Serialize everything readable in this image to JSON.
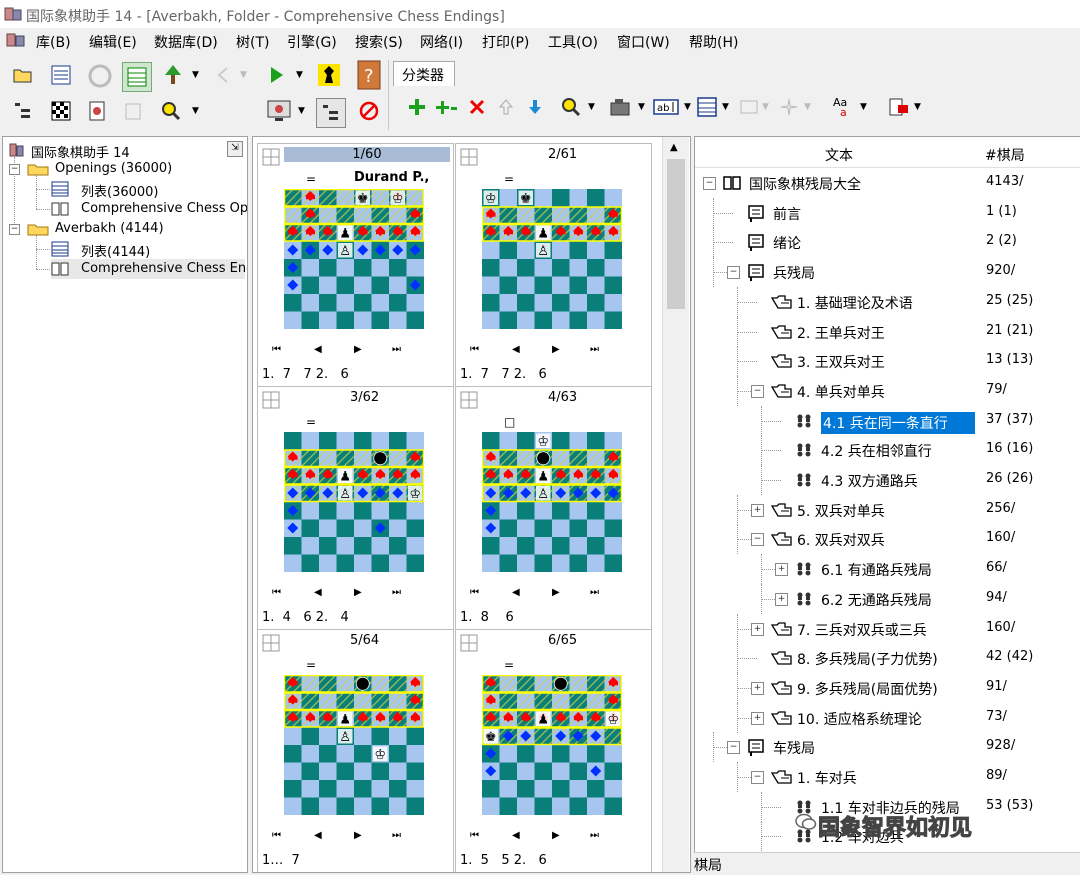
{
  "window": {
    "title": "国际象棋助手 14 - [Averbakh, Folder - Comprehensive Chess Endings]"
  },
  "menu": [
    "库(B)",
    "编辑(E)",
    "数据库(D)",
    "树(T)",
    "引擎(G)",
    "搜索(S)",
    "网络(I)",
    "打印(P)",
    "工具(O)",
    "窗口(W)",
    "帮助(H)"
  ],
  "tab": {
    "label": "分类器"
  },
  "left_tree": {
    "root": "国际象棋助手 14",
    "items": [
      {
        "label": "Openings (36000)"
      },
      {
        "label": "列表(36000)"
      },
      {
        "label": "Comprehensive Chess Oper"
      },
      {
        "label": "Averbakh (4144)"
      },
      {
        "label": "列表(4144)"
      },
      {
        "label": "Comprehensive Chess Endir"
      }
    ]
  },
  "games": [
    {
      "num": "1/60",
      "eq": "=",
      "name": "Durand P.,",
      "moves": "1.  7   7 2.   6",
      "selected": true
    },
    {
      "num": "2/61",
      "eq": "=",
      "name": "",
      "moves": "1.  7   7 2.   6",
      "selected": false
    },
    {
      "num": "3/62",
      "eq": "=",
      "name": "",
      "moves": "1.  4   6 2.   4",
      "selected": false
    },
    {
      "num": "4/63",
      "eq": "□",
      "name": "",
      "moves": "1.  8    6",
      "selected": false
    },
    {
      "num": "5/64",
      "eq": "=",
      "name": "",
      "moves": "1…  7",
      "selected": false
    },
    {
      "num": "6/65",
      "eq": "=",
      "name": "",
      "moves": "1.  5   5 2.   6",
      "selected": false
    }
  ],
  "right_tree": {
    "headers": {
      "text": "文本",
      "count": "#棋局"
    },
    "rows": [
      {
        "label": "国际象棋残局大全",
        "count": "4143/",
        "level": 0,
        "exp": "−",
        "icon": "book-icon"
      },
      {
        "label": "前言",
        "count": "1 (1)",
        "level": 1,
        "exp": "",
        "icon": "page-icon"
      },
      {
        "label": "绪论",
        "count": "2 (2)",
        "level": 1,
        "exp": "",
        "icon": "page-icon"
      },
      {
        "label": "兵残局",
        "count": "920/",
        "level": 1,
        "exp": "−",
        "icon": "page-icon"
      },
      {
        "label": "1. 基础理论及术语",
        "count": "25 (25)",
        "level": 2,
        "exp": "",
        "icon": "note-icon"
      },
      {
        "label": "2. 王单兵对王",
        "count": "21 (21)",
        "level": 2,
        "exp": "",
        "icon": "note-icon"
      },
      {
        "label": "3. 王双兵对王",
        "count": "13 (13)",
        "level": 2,
        "exp": "",
        "icon": "note-icon"
      },
      {
        "label": "4. 单兵对单兵",
        "count": "79/",
        "level": 2,
        "exp": "−",
        "icon": "note-icon"
      },
      {
        "label": "4.1 兵在同一条直行",
        "count": "37 (37)",
        "level": 3,
        "exp": "",
        "icon": "pieces-icon",
        "selected": true
      },
      {
        "label": "4.2 兵在相邻直行",
        "count": "16 (16)",
        "level": 3,
        "exp": "",
        "icon": "pieces-icon"
      },
      {
        "label": "4.3 双方通路兵",
        "count": "26 (26)",
        "level": 3,
        "exp": "",
        "icon": "pieces-icon"
      },
      {
        "label": "5. 双兵对单兵",
        "count": "256/",
        "level": 2,
        "exp": "+",
        "icon": "note-icon"
      },
      {
        "label": "6. 双兵对双兵",
        "count": "160/",
        "level": 2,
        "exp": "−",
        "icon": "note-icon"
      },
      {
        "label": "6.1 有通路兵残局",
        "count": "66/",
        "level": 3,
        "exp": "+",
        "icon": "pieces-icon"
      },
      {
        "label": "6.2 无通路兵残局",
        "count": "94/",
        "level": 3,
        "exp": "+",
        "icon": "pieces-icon"
      },
      {
        "label": "7. 三兵对双兵或三兵",
        "count": "160/",
        "level": 2,
        "exp": "+",
        "icon": "note-icon"
      },
      {
        "label": "8. 多兵残局(子力优势)",
        "count": "42 (42)",
        "level": 2,
        "exp": "",
        "icon": "note-icon"
      },
      {
        "label": "9. 多兵残局(局面优势)",
        "count": "91/",
        "level": 2,
        "exp": "+",
        "icon": "note-icon"
      },
      {
        "label": "10. 适应格系统理论",
        "count": "73/",
        "level": 2,
        "exp": "+",
        "icon": "note-icon"
      },
      {
        "label": "车残局",
        "count": "928/",
        "level": 1,
        "exp": "−",
        "icon": "page-icon"
      },
      {
        "label": "1. 车对兵",
        "count": "89/",
        "level": 2,
        "exp": "−",
        "icon": "note-icon"
      },
      {
        "label": "1.1 车对非边兵的残局",
        "count": "53 (53)",
        "level": 3,
        "exp": "",
        "icon": "pieces-icon"
      },
      {
        "label": "1.2 车对边兵",
        "count": "",
        "level": 3,
        "exp": "",
        "icon": "pieces-icon"
      }
    ]
  },
  "status": {
    "text": "棋局"
  },
  "watermark": {
    "text": "国象智界如初见"
  },
  "colors": {
    "board_dark": "#0a7f7a",
    "board_light": "#a7c6ef",
    "highlight": "#ffff00",
    "selection": "#0078d7",
    "mark_red": "#ff0000",
    "mark_blue": "#0030ff"
  }
}
